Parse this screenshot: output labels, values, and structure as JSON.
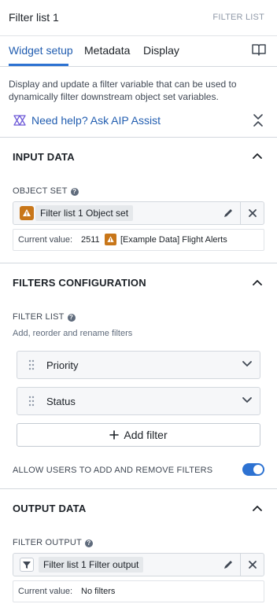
{
  "header": {
    "title": "Filter list 1",
    "type_label": "FILTER LIST"
  },
  "tabs": [
    {
      "label": "Widget setup",
      "active": true
    },
    {
      "label": "Metadata",
      "active": false
    },
    {
      "label": "Display",
      "active": false
    }
  ],
  "description": "Display and update a filter variable that can be used to dynamically filter downstream object set variables.",
  "help_link": "Need help? Ask AIP Assist",
  "input_data": {
    "title": "INPUT DATA",
    "object_set_label": "OBJECT SET",
    "object_set_value": "Filter list 1 Object set",
    "current_value_label": "Current value:",
    "current_count": "2511",
    "current_name": "[Example Data] Flight Alerts"
  },
  "filters_config": {
    "title": "FILTERS CONFIGURATION",
    "filter_list_label": "FILTER LIST",
    "filter_list_hint": "Add, reorder and rename filters",
    "filters": [
      {
        "name": "Priority"
      },
      {
        "name": "Status"
      }
    ],
    "add_filter_label": "Add filter",
    "allow_toggle_label": "ALLOW USERS TO ADD AND REMOVE FILTERS",
    "allow_toggle_on": true
  },
  "output_data": {
    "title": "OUTPUT DATA",
    "filter_output_label": "FILTER OUTPUT",
    "filter_output_value": "Filter list 1 Filter output",
    "current_value_label": "Current value:",
    "current_value": "No filters"
  },
  "colors": {
    "accent": "#2d72d2",
    "warning": "#c87619",
    "link": "#215db0",
    "border": "#d3d8de"
  },
  "icons": [
    "book-icon",
    "aip-assist-icon",
    "collapse-all-icon",
    "chevron-up-icon",
    "help-icon",
    "warning-icon",
    "pencil-icon",
    "close-icon",
    "drag-handle-icon",
    "chevron-down-icon",
    "plus-icon",
    "filter-icon"
  ]
}
